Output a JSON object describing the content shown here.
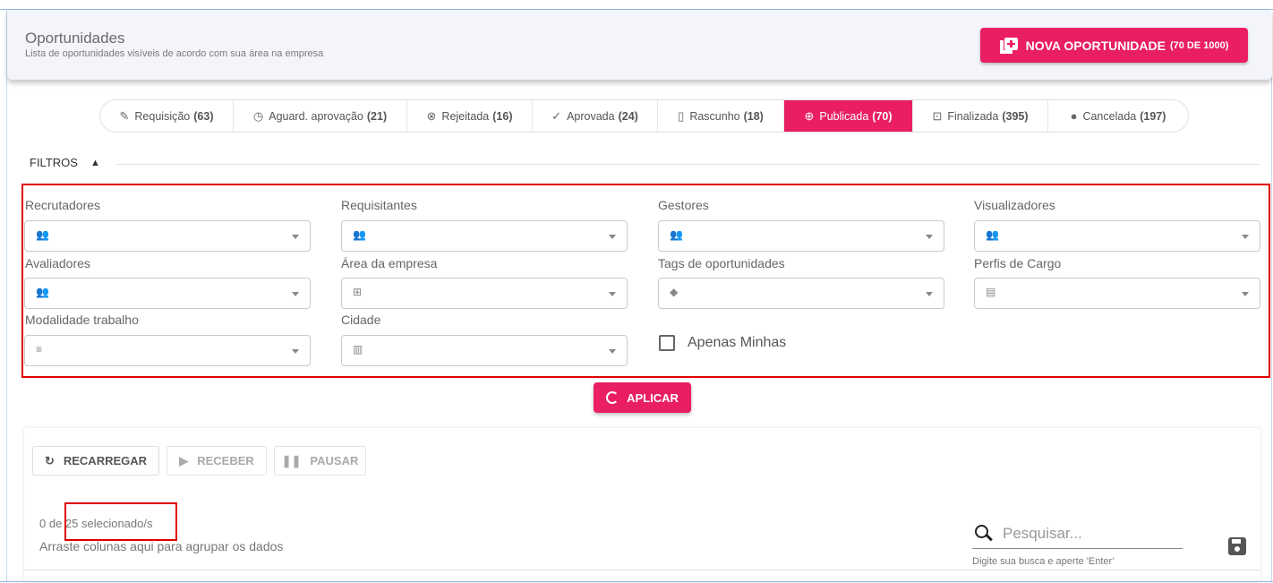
{
  "header": {
    "title": "Oportunidades",
    "subtitle": "Lista de oportunidades visíveis de acordo com sua área na empresa",
    "new_button": {
      "label": "NOVA OPORTUNIDADE",
      "count": "(70 DE 1000)"
    }
  },
  "tabs": [
    {
      "icon": "✎",
      "label": "Requisição",
      "count": "(63)"
    },
    {
      "icon": "◷",
      "label": "Aguard. aprovação",
      "count": "(21)"
    },
    {
      "icon": "⊗",
      "label": "Rejeitada",
      "count": "(16)"
    },
    {
      "icon": "✓",
      "label": "Aprovada",
      "count": "(24)"
    },
    {
      "icon": "▯",
      "label": "Rascunho",
      "count": "(18)"
    },
    {
      "icon": "⊕",
      "label": "Publicada",
      "count": "(70)",
      "active": true
    },
    {
      "icon": "⊡",
      "label": "Finalizada",
      "count": "(395)"
    },
    {
      "icon": "●",
      "label": "Cancelada",
      "count": "(197)"
    }
  ],
  "filters": {
    "title": "FILTROS",
    "fields": {
      "recrutadores": "Recrutadores",
      "requisitantes": "Requisitantes",
      "gestores": "Gestores",
      "visualizadores": "Visualizadores",
      "avaliadores": "Avaliadores",
      "area_empresa": "Área da empresa",
      "tags": "Tags de oportunidades",
      "perfis_cargo": "Perfis de Cargo",
      "modalidade": "Modalidade trabalho",
      "cidade": "Cidade"
    },
    "only_mine": "Apenas Minhas",
    "apply": "APLICAR"
  },
  "toolbar": {
    "reload": "RECARREGAR",
    "receive": "RECEBER",
    "pause": "PAUSAR"
  },
  "grid": {
    "selection_count": "0 de 25 selecionado/s",
    "group_hint": "Arraste colunas aqui para agrupar os dados",
    "search_placeholder": "Pesquisar...",
    "search_hint": "Digite sua busca e aperte 'Enter'"
  },
  "colors": {
    "accent": "#e91e63",
    "highlight": "#e00000"
  }
}
